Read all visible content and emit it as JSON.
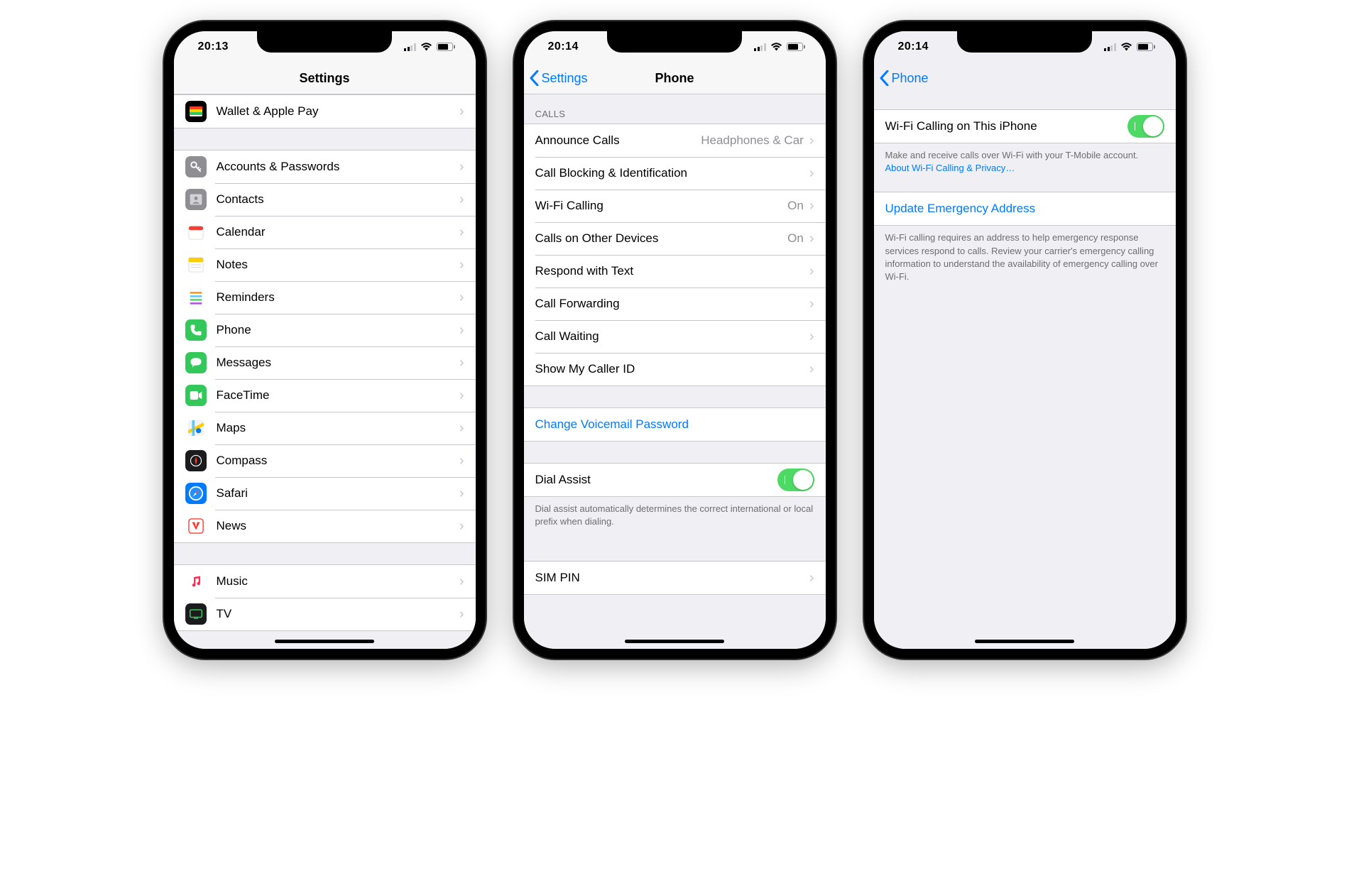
{
  "screens": [
    {
      "status_time": "20:13",
      "nav_title": "Settings",
      "top_item": {
        "label": "Wallet & Apple Pay",
        "icon": "wallet",
        "bg": "#000"
      },
      "groupA": [
        {
          "label": "Accounts & Passwords",
          "icon": "key",
          "bg": "#8e8e93"
        },
        {
          "label": "Contacts",
          "icon": "contacts",
          "bg": "#8e8e93"
        },
        {
          "label": "Calendar",
          "icon": "calendar",
          "bg": "#fff"
        },
        {
          "label": "Notes",
          "icon": "notes",
          "bg": "#fff"
        },
        {
          "label": "Reminders",
          "icon": "reminders",
          "bg": "#fff"
        },
        {
          "label": "Phone",
          "icon": "phone",
          "bg": "#34c759"
        },
        {
          "label": "Messages",
          "icon": "messages",
          "bg": "#34c759"
        },
        {
          "label": "FaceTime",
          "icon": "facetime",
          "bg": "#34c759"
        },
        {
          "label": "Maps",
          "icon": "maps",
          "bg": "#fff"
        },
        {
          "label": "Compass",
          "icon": "compass",
          "bg": "#1c1c1e"
        },
        {
          "label": "Safari",
          "icon": "safari",
          "bg": "#007aff"
        },
        {
          "label": "News",
          "icon": "news",
          "bg": "#fff"
        }
      ],
      "groupB": [
        {
          "label": "Music",
          "icon": "music",
          "bg": "#fff"
        },
        {
          "label": "TV",
          "icon": "tv",
          "bg": "#1c1c1e"
        }
      ]
    },
    {
      "status_time": "20:14",
      "nav_back": "Settings",
      "nav_title": "Phone",
      "calls_header": "CALLS",
      "calls": [
        {
          "label": "Announce Calls",
          "detail": "Headphones & Car"
        },
        {
          "label": "Call Blocking & Identification",
          "detail": ""
        },
        {
          "label": "Wi-Fi Calling",
          "detail": "On"
        },
        {
          "label": "Calls on Other Devices",
          "detail": "On"
        },
        {
          "label": "Respond with Text",
          "detail": ""
        },
        {
          "label": "Call Forwarding",
          "detail": ""
        },
        {
          "label": "Call Waiting",
          "detail": ""
        },
        {
          "label": "Show My Caller ID",
          "detail": ""
        }
      ],
      "voicemail_label": "Change Voicemail Password",
      "dial_assist_label": "Dial Assist",
      "dial_assist_footer": "Dial assist automatically determines the correct international or local prefix when dialing.",
      "sim_pin_label": "SIM PIN"
    },
    {
      "status_time": "20:14",
      "nav_back": "Phone",
      "wifi_toggle_label": "Wi-Fi Calling on This iPhone",
      "wifi_footer_text": "Make and receive calls over Wi-Fi with your T-Mobile account. ",
      "wifi_footer_link": "About Wi-Fi Calling & Privacy…",
      "update_addr_label": "Update Emergency Address",
      "addr_footer": "Wi-Fi calling requires an address to help emergency response services respond to calls. Review your carrier's emergency calling information to understand the availability of emergency calling over Wi-Fi."
    }
  ]
}
